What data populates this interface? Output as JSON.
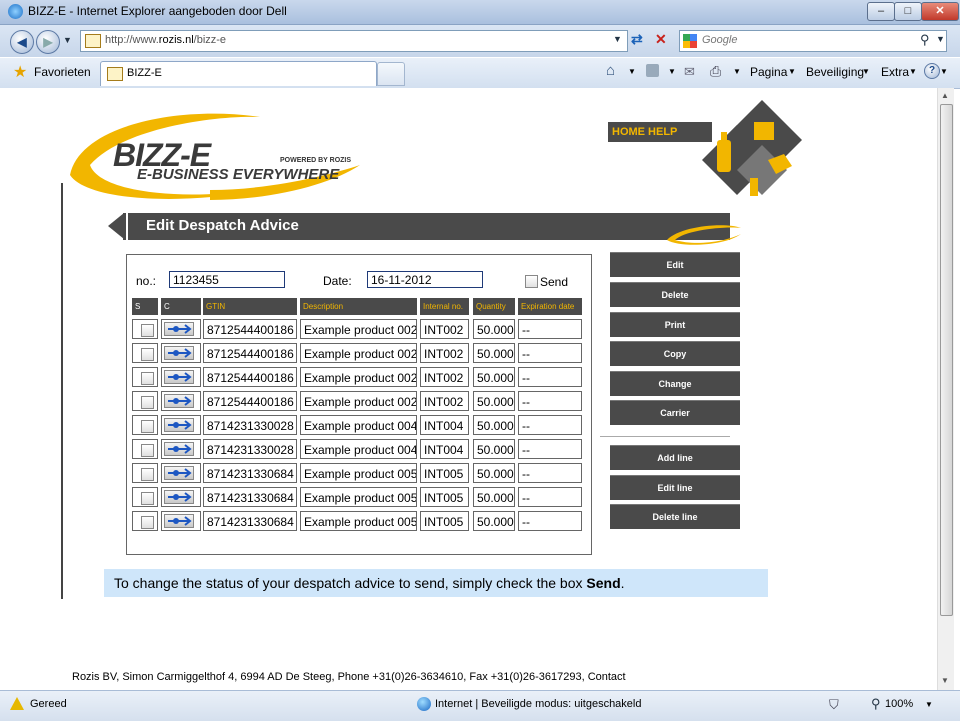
{
  "window": {
    "title": "BIZZ-E - Internet Explorer aangeboden door Dell",
    "min": "–",
    "max": "□",
    "close": "✕"
  },
  "address": {
    "url_prefix": "http://www.",
    "url_domain": "rozis.nl",
    "url_path": "/bizz-e",
    "search_placeholder": "Google"
  },
  "favorites": {
    "label": "Favorieten",
    "tab_label": "BIZZ-E"
  },
  "commandbar": {
    "page": "Pagina",
    "safety": "Beveiliging",
    "extra": "Extra"
  },
  "logo": {
    "brand": "BIZZ-E",
    "tagline": "E-BUSINESS EVERYWHERE",
    "powered": "POWERED BY ROZIS"
  },
  "homehelp": "HOME HELP",
  "page_title": "Edit Despatch Advice",
  "form": {
    "no_label": "no.:",
    "no_value": "1123455",
    "date_label": "Date:",
    "date_value": "16-11-2012",
    "send_label": "Send"
  },
  "table": {
    "headers": [
      "S",
      "C",
      "GTIN",
      "Description",
      "Internal no.",
      "Quantity",
      "Expiration date"
    ],
    "rows": [
      {
        "gtin": "8712544400186",
        "desc": "Example product 002",
        "internal": "INT002",
        "qty": "50.000",
        "exp": "--"
      },
      {
        "gtin": "8712544400186",
        "desc": "Example product 002",
        "internal": "INT002",
        "qty": "50.000",
        "exp": "--"
      },
      {
        "gtin": "8712544400186",
        "desc": "Example product 002",
        "internal": "INT002",
        "qty": "50.000",
        "exp": "--"
      },
      {
        "gtin": "8712544400186",
        "desc": "Example product 002",
        "internal": "INT002",
        "qty": "50.000",
        "exp": "--"
      },
      {
        "gtin": "8714231330028",
        "desc": "Example product 004",
        "internal": "INT004",
        "qty": "50.000",
        "exp": "--"
      },
      {
        "gtin": "8714231330028",
        "desc": "Example product 004",
        "internal": "INT004",
        "qty": "50.000",
        "exp": "--"
      },
      {
        "gtin": "8714231330684",
        "desc": "Example product 005",
        "internal": "INT005",
        "qty": "50.000",
        "exp": "--"
      },
      {
        "gtin": "8714231330684",
        "desc": "Example product 005",
        "internal": "INT005",
        "qty": "50.000",
        "exp": "--"
      },
      {
        "gtin": "8714231330684",
        "desc": "Example product 005",
        "internal": "INT005",
        "qty": "50.000",
        "exp": "--"
      }
    ]
  },
  "actions": {
    "edit": "Edit",
    "delete": "Delete",
    "print": "Print",
    "copy": "Copy",
    "change": "Change",
    "carrier": "Carrier",
    "add_line": "Add line",
    "edit_line": "Edit line",
    "delete_line": "Delete line"
  },
  "info": {
    "text": "To change the status of your despatch advice to send, simply check the box ",
    "bold": "Send",
    "end": "."
  },
  "footer": "Rozis BV, Simon Carmiggelthof 4, 6994 AD De Steeg, Phone +31(0)26-3634610, Fax +31(0)26-3617293, Contact",
  "status": {
    "left": "Gereed",
    "zone": "Internet | Beveiligde modus: uitgeschakeld",
    "zoom": "100%"
  },
  "colors": {
    "accent": "#f2b600",
    "dark": "#4a4a4a",
    "info_bg": "#cfe6fa"
  }
}
